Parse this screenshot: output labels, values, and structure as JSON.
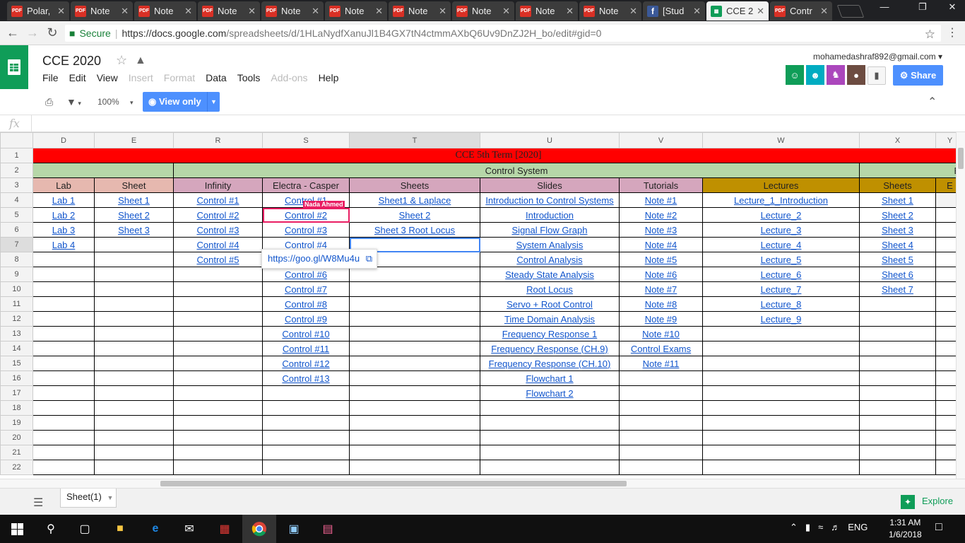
{
  "browser": {
    "tabs": [
      {
        "icon": "pdf-icon",
        "title": "Polar,"
      },
      {
        "icon": "pdf-icon",
        "title": "Note"
      },
      {
        "icon": "pdf-icon",
        "title": "Note"
      },
      {
        "icon": "pdf-icon",
        "title": "Note"
      },
      {
        "icon": "pdf-icon",
        "title": "Note"
      },
      {
        "icon": "pdf-icon",
        "title": "Note"
      },
      {
        "icon": "pdf-icon",
        "title": "Note"
      },
      {
        "icon": "pdf-icon",
        "title": "Note"
      },
      {
        "icon": "pdf-icon",
        "title": "Note"
      },
      {
        "icon": "pdf-icon",
        "title": "Note"
      },
      {
        "icon": "facebook-icon",
        "title": "[Stud"
      },
      {
        "icon": "sheets-icon",
        "title": "CCE 2"
      },
      {
        "icon": "pdf-icon",
        "title": "Contr"
      }
    ],
    "active_tab": 11,
    "security_label": "Secure",
    "url_domain": "https://docs.google.com",
    "url_path": "/spreadsheets/d/1HLaNydfXanuJl1B4GX7tN4ctmmAXbQ6Uv9DnZJ2H_bo/edit#gid=0"
  },
  "doc": {
    "title": "CCE 2020",
    "menus": [
      {
        "label": "File",
        "disabled": false
      },
      {
        "label": "Edit",
        "disabled": false
      },
      {
        "label": "View",
        "disabled": false
      },
      {
        "label": "Insert",
        "disabled": true
      },
      {
        "label": "Format",
        "disabled": true
      },
      {
        "label": "Data",
        "disabled": false
      },
      {
        "label": "Tools",
        "disabled": false
      },
      {
        "label": "Add-ons",
        "disabled": true
      },
      {
        "label": "Help",
        "disabled": false
      }
    ],
    "account_email": "mohamedashraf892@gmail.com",
    "share_label": "Share",
    "avatar_colors": [
      "#0f9d58",
      "#00acc1",
      "#ab47bc",
      "#6d4c41"
    ]
  },
  "toolbar": {
    "zoom": "100%",
    "view_only_label": "View only"
  },
  "formula_bar": {
    "fx_label": "fx"
  },
  "sheet": {
    "columns": [
      "D",
      "E",
      "R",
      "S",
      "T",
      "U",
      "V",
      "W",
      "X",
      "Y"
    ],
    "row_numbers": [
      "1",
      "2",
      "3",
      "4",
      "5",
      "6",
      "7",
      "8",
      "9",
      "10",
      "11",
      "12",
      "13",
      "14",
      "15",
      "16",
      "17",
      "18",
      "19",
      "20",
      "21",
      "22"
    ],
    "row1_title": "CCE 5th Term [2020]",
    "row2_group": "Control System",
    "row2_next_group": "El",
    "row3_headers": [
      "Lab",
      "Sheet",
      "Infinity",
      "Electra - Casper",
      "Sheets",
      "Slides",
      "Tutorials",
      "Lectures",
      "Sheets",
      "E"
    ],
    "col_D": [
      "Lab 1",
      "Lab 2",
      "Lab 3",
      "Lab 4"
    ],
    "col_E": [
      "Sheet 1",
      "Sheet 2",
      "Sheet 3"
    ],
    "col_R": [
      "Control #1",
      "Control #2",
      "Control #3",
      "Control #4",
      "Control #5"
    ],
    "col_S": [
      "Control #1",
      "Control #2",
      "Control #3",
      "Control #4",
      "Control #5",
      "Control #6",
      "Control #7",
      "Control #8",
      "Control #9",
      "Control #10",
      "Control #11",
      "Control #12",
      "Control #13"
    ],
    "col_T": [
      "Sheet1 & Laplace",
      "Sheet 2",
      "Sheet 3 Root Locus"
    ],
    "col_U": [
      "Introduction to Control Systems",
      "Introduction ",
      "Signal Flow Graph",
      "System Analysis",
      "Control Analysis ",
      "Steady State Analysis ",
      "Root Locus",
      "Servo + Root Control ",
      "Time Domain Analysis ",
      "Frequency Response 1",
      "Frequency Response (CH.9)",
      "Frequency Response (CH.10)",
      "Flowchart 1",
      "Flowchart 2"
    ],
    "col_V": [
      "Note #1",
      "Note #2",
      "Note #3",
      "Note #4",
      "Note #5",
      "Note #6",
      "Note #7",
      "Note #8",
      "Note #9",
      "Note #10",
      "Control Exams",
      "Note #11"
    ],
    "col_W": [
      "Lecture_1_Introduction",
      "Lecture_2",
      "Lecture_3",
      "Lecture_4",
      "Lecture_5",
      "Lecture_6",
      "Lecture_7",
      "Lecture_8",
      "Lecture_9"
    ],
    "col_X": [
      "Sheet 1",
      "Sheet 2 ",
      "Sheet 3",
      "Sheet 4",
      "Sheet 5",
      "Sheet 6",
      "Sheet 7"
    ],
    "collaborator_name": "Nada Ahmed",
    "collaborator_color": "#e91e63",
    "link_popup_url": "https://goo.gl/W8Mu4u",
    "header_colors": {
      "title": "#ff0000",
      "group": "#b6d7a8",
      "lab": "#e6b8af",
      "control": "#d5a6bd",
      "elec": "#bf9000"
    }
  },
  "bottom": {
    "sheet_tab": "Sheet(1)",
    "explore_label": "Explore"
  },
  "taskbar": {
    "language": "ENG",
    "time": "1:31 AM",
    "date": "1/6/2018"
  }
}
